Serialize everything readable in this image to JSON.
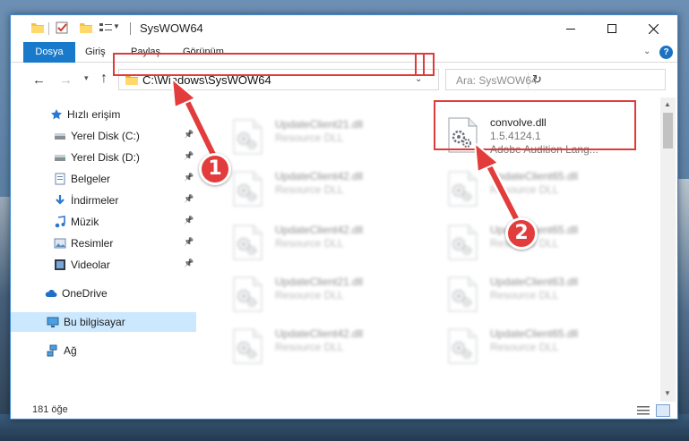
{
  "window": {
    "title": "SysWOW64"
  },
  "ribbon": {
    "tabs": [
      "Dosya",
      "Giriş",
      "Paylaş",
      "Görünüm"
    ]
  },
  "navigation": {
    "address": "C:\\Windows\\SysWOW64",
    "search_placeholder": "Ara: SysWOW64"
  },
  "sidebar": {
    "items": [
      {
        "label": "Hızlı erişim",
        "icon": "star-icon"
      },
      {
        "label": "Yerel Disk (C:)",
        "icon": "drive-icon",
        "pinned": true
      },
      {
        "label": "Yerel Disk (D:)",
        "icon": "drive-icon",
        "pinned": true
      },
      {
        "label": "Belgeler",
        "icon": "documents-icon",
        "pinned": true
      },
      {
        "label": "İndirmeler",
        "icon": "download-icon",
        "pinned": true
      },
      {
        "label": "Müzik",
        "icon": "music-icon",
        "pinned": true
      },
      {
        "label": "Resimler",
        "icon": "pictures-icon",
        "pinned": true
      },
      {
        "label": "Videolar",
        "icon": "video-icon",
        "pinned": true
      },
      {
        "label": "OneDrive",
        "icon": "cloud-icon"
      },
      {
        "label": "Bu bilgisayar",
        "icon": "computer-icon",
        "selected": true
      },
      {
        "label": "Ağ",
        "icon": "network-icon"
      }
    ]
  },
  "files": [
    {
      "name": "UpdateClient21.dll",
      "desc": "Resource DLL",
      "blurred": true
    },
    {
      "name": "convolve.dll",
      "version": "1.5.4124.1",
      "desc": "Adobe Audition Lang...",
      "blurred": false
    },
    {
      "name": "UpdateClient42.dll",
      "desc": "Resource DLL",
      "blurred": true
    },
    {
      "name": "UpdateClient65.dll",
      "desc": "Resource DLL",
      "blurred": true
    },
    {
      "name": "UpdateClient42.dll",
      "desc": "Resource DLL",
      "blurred": true
    },
    {
      "name": "UpdateClient65.dll",
      "desc": "Resource DLL",
      "blurred": true
    },
    {
      "name": "UpdateClient21.dll",
      "desc": "Resource DLL",
      "blurred": true
    },
    {
      "name": "UpdateClient63.dll",
      "desc": "Resource DLL",
      "blurred": true
    },
    {
      "name": "UpdateClient42.dll",
      "desc": "Resource DLL",
      "blurred": true
    },
    {
      "name": "UpdateClient65.dll",
      "desc": "Resource DLL",
      "blurred": true
    }
  ],
  "status": {
    "item_count": "181 öğe"
  },
  "annotations": {
    "badge_1": "1",
    "badge_2": "2",
    "highlight_color": "#e03b3b"
  },
  "colors": {
    "accent": "#1979ca",
    "selection": "#cce8ff"
  }
}
